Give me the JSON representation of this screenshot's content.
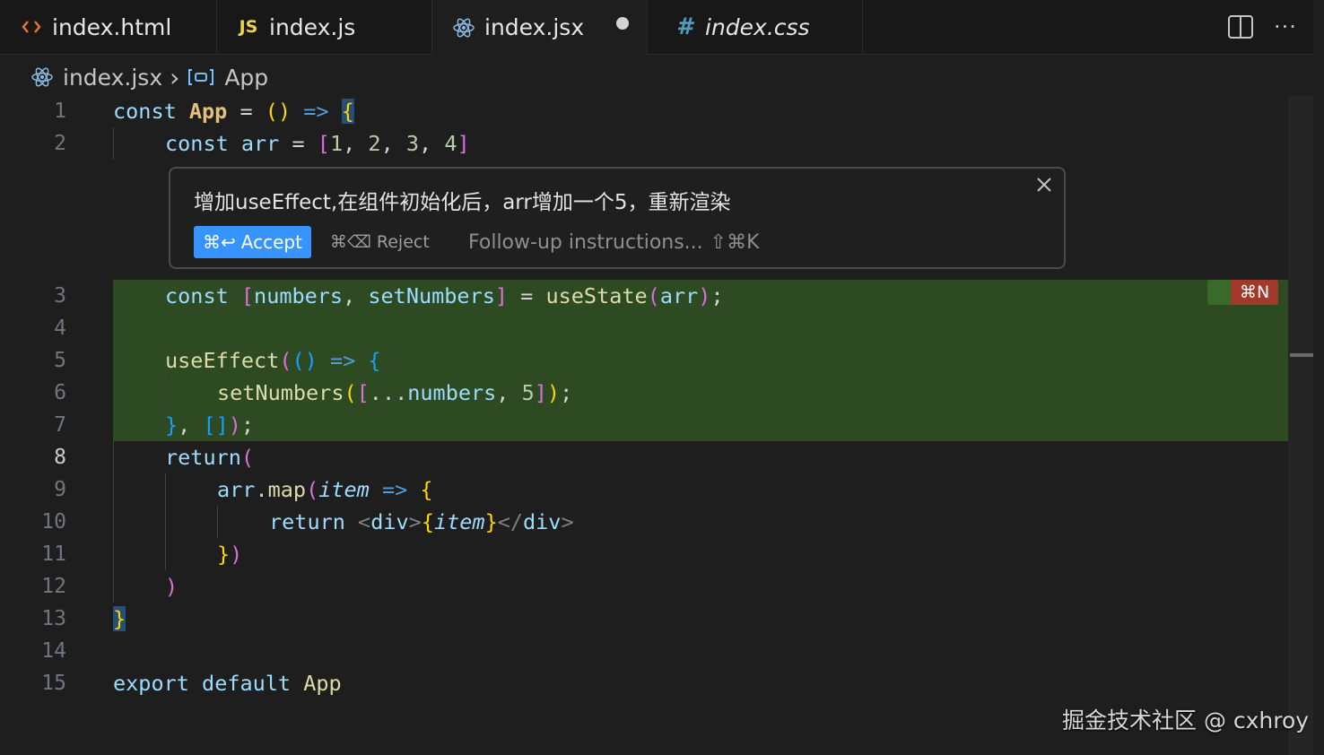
{
  "tabs": [
    {
      "label": "index.html",
      "icon": "html-brackets-icon"
    },
    {
      "label": "index.js",
      "icon": "js-icon",
      "icon_text": "JS"
    },
    {
      "label": "index.jsx",
      "icon": "react-icon",
      "dirty": true
    },
    {
      "label": "index.css",
      "icon": "hash-icon",
      "icon_text": "#"
    }
  ],
  "tab_actions": {
    "split": "split-editor-icon",
    "more": "···"
  },
  "breadcrumb": {
    "file": "index.jsx",
    "separator": "›",
    "symbol": "App"
  },
  "line_numbers": [
    "1",
    "2",
    "3",
    "4",
    "5",
    "6",
    "7",
    "8",
    "9",
    "10",
    "11",
    "12",
    "13",
    "14",
    "15"
  ],
  "code": {
    "l1": {
      "a": "const ",
      "b": "App",
      "c": " = ",
      "d": "()",
      "e": " => ",
      "f": "{"
    },
    "l2": {
      "a": "const ",
      "b": "arr",
      "c": " = ",
      "d": "[",
      "e": "1",
      "f": ", ",
      "g": "2",
      "h": ", ",
      "i": "3",
      "j": ", ",
      "k": "4",
      "l": "]"
    },
    "l3": {
      "a": "const ",
      "b": "[",
      "c": "numbers",
      "d": ", ",
      "e": "setNumbers",
      "f": "]",
      "g": " = ",
      "h": "useState",
      "i": "(",
      "j": "arr",
      "k": ")",
      "l": ";"
    },
    "l5": {
      "a": "useEffect",
      "b": "(",
      "c": "()",
      "d": " => ",
      "e": "{"
    },
    "l6": {
      "a": "setNumbers",
      "b": "(",
      "c": "[",
      "d": "...",
      "e": "numbers",
      "f": ", ",
      "g": "5",
      "h": "]",
      "i": ")",
      "j": ";"
    },
    "l7": {
      "a": "}",
      "b": ", ",
      "c": "[]",
      "d": ")",
      "e": ";"
    },
    "l8": {
      "a": "return",
      "b": "("
    },
    "l9": {
      "a": "arr",
      "b": ".",
      "c": "map",
      "d": "(",
      "e": "item",
      "f": " => ",
      "g": "{"
    },
    "l10": {
      "a": "return ",
      "b": "<",
      "c": "div",
      "d": ">",
      "e": "{",
      "f": "item",
      "g": "}",
      "h": "</",
      "i": "div",
      "j": ">"
    },
    "l11": {
      "a": "}",
      "b": ")"
    },
    "l12": {
      "a": ")"
    },
    "l13": {
      "a": "}"
    },
    "l15": {
      "a": "export ",
      "b": "default ",
      "c": "App"
    }
  },
  "inline_prompt": {
    "text": "增加useEffect,在组件初始化后，arr增加一个5，重新渲染",
    "accept_shortcut": "⌘↩",
    "accept_label": "Accept",
    "reject_shortcut": "⌘⌫",
    "reject_label": "Reject",
    "followup_placeholder": "Follow-up instructions...",
    "followup_shortcut": "⇧⌘K",
    "close": "close-icon"
  },
  "shortcut_badge": "⌘N",
  "watermark": "掘金技术社区 @ cxhroy",
  "colors": {
    "editor_bg": "#1e1e1e",
    "diff_added_bg": "#2d4a22",
    "accept_blue": "#3794ff",
    "badge_red": "#a03a2a"
  }
}
